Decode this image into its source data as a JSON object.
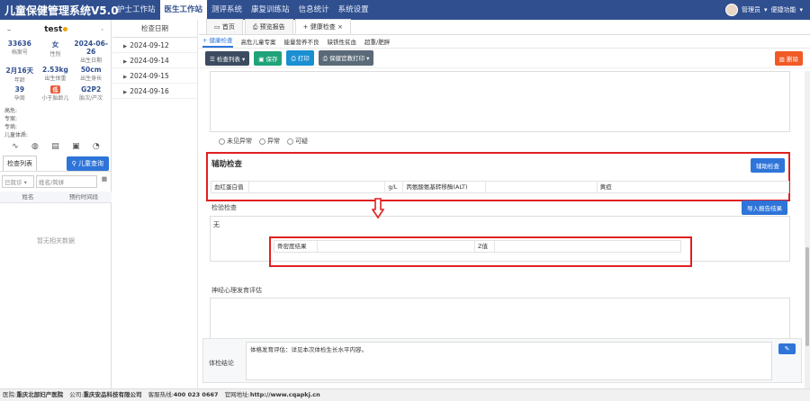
{
  "app": {
    "title": "儿童保健管理系统V5.0",
    "nav": [
      "护士工作站",
      "医生工作站",
      "测评系统",
      "康复训练站",
      "信息统计",
      "系统设置"
    ],
    "active_nav": "医生工作站",
    "user": "管理员",
    "quick": "便捷功能"
  },
  "patient": {
    "name": "test",
    "file_no": "33636",
    "file_no_label": "档案号",
    "sex": "女",
    "sex_label": "性别",
    "birth_date": "2024-06-26",
    "birth_date_label": "出生日期",
    "age": "2月16天",
    "age_label": "年龄",
    "birth_weight": "2.53kg",
    "birth_weight_label": "出生体重",
    "birth_length": "50cm",
    "birth_length_label": "出生身长",
    "gest": "39",
    "gest_label": "孕周",
    "sga": "低",
    "sga_label": "小于胎龄儿",
    "parity": "G2P2",
    "parity_label": "胎次/产次",
    "high_risk": "高危:",
    "special": "专案:",
    "special_case": "专病:",
    "physique": "儿童体质:"
  },
  "left": {
    "tab": "检查列表",
    "query_btn": "儿童查询",
    "filter_value": "已就诊",
    "filter_placeholder": "姓名/简拼",
    "col_name": "姓名",
    "col_appt": "预约时间段",
    "empty": "暂无相关数据"
  },
  "dates": {
    "header": "检查日期",
    "items": [
      "2024-09-12",
      "2024-09-14",
      "2024-09-15",
      "2024-09-16"
    ]
  },
  "tabs": {
    "home": "首页",
    "report": "预览报告",
    "check": "健康检查"
  },
  "subtabs": [
    "+ 健康检查",
    "高危儿童专案",
    "能量营养不良",
    "缺铁性贫血",
    "超重/肥胖"
  ],
  "toolbar": {
    "list": "检查列表",
    "save": "保存",
    "print": "打印",
    "print2": "保健官教打印",
    "delete": "删除"
  },
  "form": {
    "radios": [
      "未见异常",
      "异常",
      "可疑"
    ],
    "aux_title": "辅助检查",
    "aux_btn": "辅助检查",
    "aux_fields": [
      "血红蛋白值",
      "",
      "g/L",
      "丙氨酸氨基转移酶(ALT)",
      "",
      "黄疸"
    ],
    "test_label": "检验检查",
    "import_btn": "导入报告结果",
    "test_none": "无",
    "bone_fields": [
      "骨密度结果",
      "",
      "Z值",
      ""
    ],
    "neuro_label": "神经心理发育评估",
    "conc_label": "体检结论",
    "conc_text": "体格发育评估：详见本次体检生长水平内容。"
  },
  "footer": {
    "hospital_label": "医院:",
    "hospital": "重庆北部妇产医院",
    "company_label": "公司:",
    "company": "重庆安品科技有限公司",
    "hotline_label": "客服热线:",
    "hotline": "400 023 0667",
    "site_label": "官网地址:",
    "site": "http://www.cqapkj.cn"
  }
}
